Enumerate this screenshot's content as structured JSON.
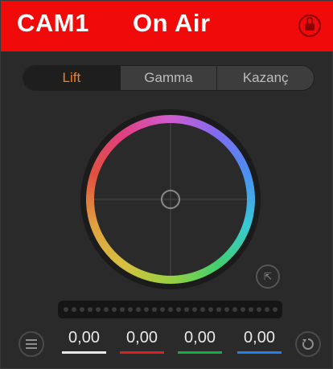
{
  "header": {
    "camera": "CAM1",
    "status": "On Air",
    "bg_color": "#f00a0a"
  },
  "tabs": [
    {
      "label": "Lift",
      "active": true
    },
    {
      "label": "Gamma",
      "active": false
    },
    {
      "label": "Kazanç",
      "active": false
    }
  ],
  "colors": {
    "accent": "#ff7b1a",
    "red": "#e02020",
    "green": "#10b040",
    "blue": "#2080f0",
    "white": "#e8e8e8"
  },
  "values": {
    "luma": "0,00",
    "red": "0,00",
    "green": "0,00",
    "blue": "0,00"
  }
}
